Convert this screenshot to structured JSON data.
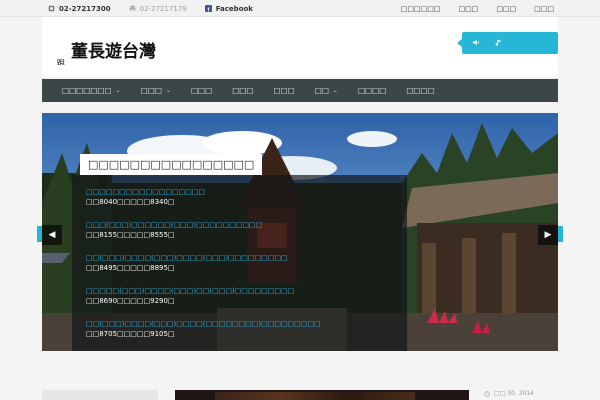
{
  "topbar": {
    "phone": "02-27217300",
    "fax": "02-27217179",
    "facebook": "Facebook",
    "links": [
      "□□□□□□",
      "□□□",
      "□□□",
      "□□□"
    ]
  },
  "header": {
    "logo_small": "跟著",
    "logo_big": "董長遊台灣"
  },
  "nav": {
    "items": [
      {
        "label": "□□□□□□□",
        "chevron": "⌄"
      },
      {
        "label": "□□□",
        "chevron": "⌄"
      },
      {
        "label": "□□□"
      },
      {
        "label": "□□□"
      },
      {
        "label": "□□□"
      },
      {
        "label": "□□",
        "chevron": "⌄"
      },
      {
        "label": "□□□□"
      },
      {
        "label": "□□□□"
      }
    ]
  },
  "slide": {
    "caption_title": "□□□□□□□□□□□□□□□□",
    "events": [
      {
        "title": "□□□□□□□□□□□□□□□□□□",
        "detail": "□□8040□□□□□8340□"
      },
      {
        "title": "□□□(□□□)□□□□□□(□□□)□□□□□□□□□□",
        "detail": "□□8155□□□□□8555□"
      },
      {
        "title": "□□(□□□)□□□□(□□□)□□□□(□□□)□□□□□□□□□",
        "detail": "□□8495□□□□□8895□"
      },
      {
        "title": "□□□□□(□□□)□□□□(□□□)□□(□□□)□□□□□□□□□",
        "detail": "□□8690□□□□□9290□"
      },
      {
        "title": "□□(□□□)□□□□(□□□)□□□□(□□□□□□□□)□□□□□□□□□",
        "detail": "□□8705□□□□□9105□"
      }
    ],
    "prev": "◀",
    "next": "▶"
  },
  "footer_preview": {
    "date": "□□ 30, 2014"
  },
  "colors": {
    "accent": "#27b6d6",
    "nav_bg": "#3b4649",
    "link": "#3ab0e0"
  }
}
